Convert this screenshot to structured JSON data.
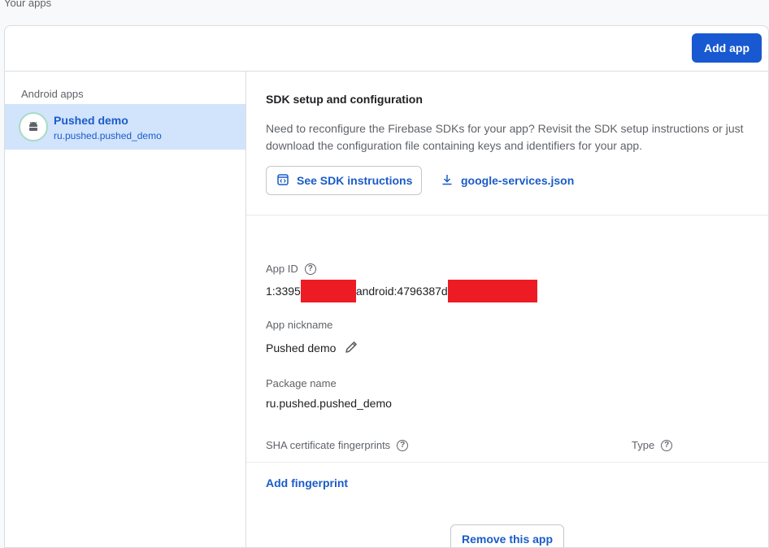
{
  "page": {
    "section_title": "Your apps"
  },
  "header": {
    "add_app_label": "Add app"
  },
  "sidebar": {
    "heading": "Android apps",
    "items": [
      {
        "name": "Pushed demo",
        "package": "ru.pushed.pushed_demo",
        "icon": "android-icon",
        "selected": true
      }
    ]
  },
  "sdk": {
    "title": "SDK setup and configuration",
    "description": "Need to reconfigure the Firebase SDKs for your app? Revisit the SDK setup instructions or just download the configuration file containing keys and identifiers for your app.",
    "instructions_button": "See SDK instructions",
    "config_file_link": "google-services.json"
  },
  "details": {
    "app_id_label": "App ID",
    "app_id_part1": "1:3395",
    "app_id_part2": "android:4796387d",
    "nickname_label": "App nickname",
    "nickname_value": "Pushed demo",
    "package_label": "Package name",
    "package_value": "ru.pushed.pushed_demo",
    "sha_label": "SHA certificate fingerprints",
    "type_label": "Type",
    "add_fingerprint": "Add fingerprint",
    "remove_app": "Remove this app"
  },
  "colors": {
    "accent": "#1859d1",
    "selected_bg": "#d2e3fc",
    "link": "#1a5cc8",
    "redaction": "#ed1c24"
  }
}
